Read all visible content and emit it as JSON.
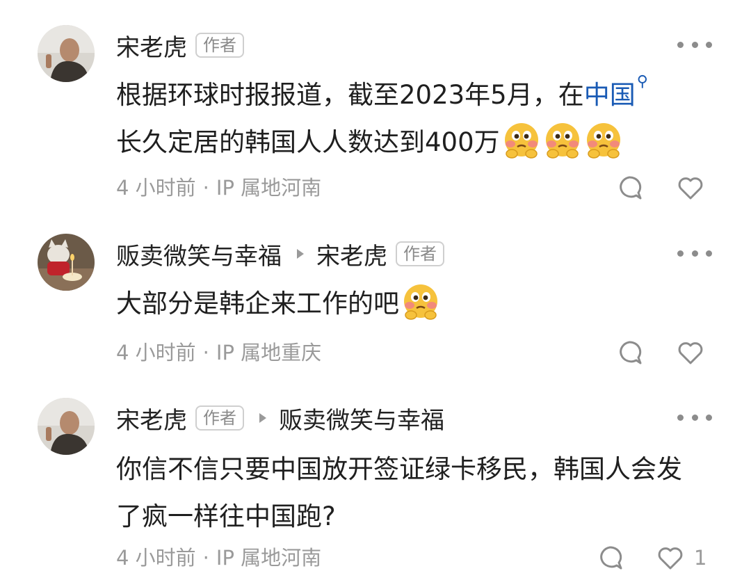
{
  "comments": [
    {
      "author": "宋老虎",
      "author_badge": "作者",
      "reply_to": "",
      "reply_to_badge": "",
      "text_part1": "根据环球时报报道，截至2023年5月，在",
      "text_link": "中国",
      "text_part2": "长久定居的韩国人人数达到400万",
      "time": "4 小时前",
      "separator": "·",
      "location": "IP 属地河南",
      "likes": "",
      "emojis": [
        "blushing-pleading-emoji",
        "blushing-pleading-emoji",
        "blushing-pleading-emoji"
      ]
    },
    {
      "author": "贩卖微笑与幸福",
      "author_badge": "",
      "reply_to": "宋老虎",
      "reply_to_badge": "作者",
      "text": "大部分是韩企来工作的吧",
      "time": "4 小时前",
      "separator": "·",
      "location": "IP 属地重庆",
      "likes": "",
      "emojis": [
        "blushing-pleading-emoji"
      ]
    },
    {
      "author": "宋老虎",
      "author_badge": "作者",
      "reply_to": "贩卖微笑与幸福",
      "reply_to_badge": "",
      "text": "你信不信只要中国放开签证绿卡移民，韩国人会发了疯一样往中国跑?",
      "time": "4 小时前",
      "separator": "·",
      "location": "IP 属地河南",
      "likes": "1",
      "emojis": []
    }
  ],
  "icons": {
    "search": "search-icon",
    "comment": "comment-bubble-icon",
    "like": "heart-icon",
    "more": "more-options-icon"
  },
  "colors": {
    "link": "#1a5bb5",
    "meta": "#9a9a9a",
    "badge_border": "#cfcfcf"
  }
}
